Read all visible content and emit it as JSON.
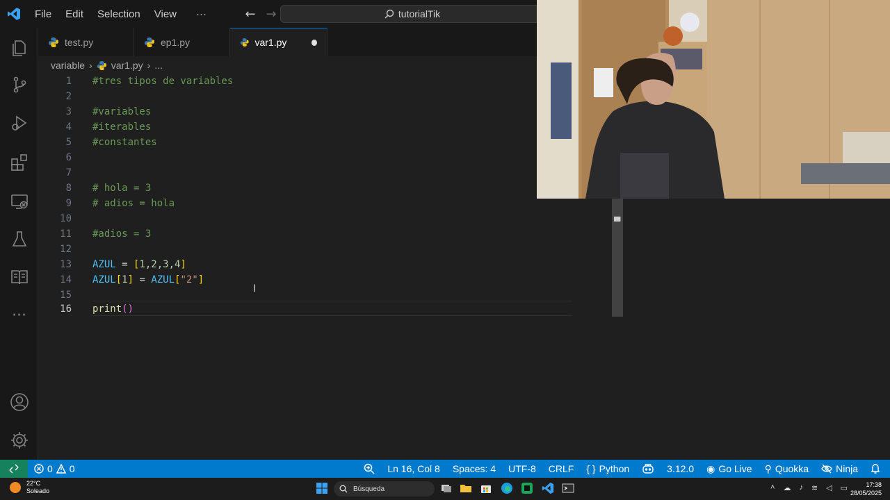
{
  "titlebar": {
    "menu": [
      "File",
      "Edit",
      "Selection",
      "View"
    ],
    "more": "···",
    "search_text": "tutorialTik"
  },
  "tabs": [
    {
      "label": "test.py"
    },
    {
      "label": "ep1.py"
    },
    {
      "label": "var1.py"
    }
  ],
  "breadcrumb": {
    "folder": "variable",
    "file": "var1.py",
    "more": "..."
  },
  "editor": {
    "line_numbers": [
      "1",
      "2",
      "3",
      "4",
      "5",
      "6",
      "7",
      "8",
      "9",
      "10",
      "11",
      "12",
      "13",
      "14",
      "15",
      "16"
    ],
    "lines": {
      "l1": "#tres tipos de variables",
      "l3": "#variables",
      "l4": "#iterables",
      "l5": "#constantes",
      "l8": "# hola = 3",
      "l9": "# adios = hola",
      "l11": "#adios = 3",
      "l13_var": "AZUL",
      "l13_eq": " = ",
      "l13_open": "[",
      "l13_vals": "1,2,3,4",
      "l13_close": "]",
      "l14_var": "AZUL",
      "l14_open": "[",
      "l14_idx": "1",
      "l14_close": "]",
      "l14_eq": " = ",
      "l14_var2": "AZUL",
      "l14_open2": "[",
      "l14_str": "\"2\"",
      "l14_close2": "]",
      "l16_fn": "print",
      "l16_parens": "()"
    }
  },
  "statusbar": {
    "errors": "0",
    "warnings": "0",
    "position": "Ln 16, Col 8",
    "spaces": "Spaces: 4",
    "encoding": "UTF-8",
    "eol": "CRLF",
    "language": "Python",
    "version": "3.12.0",
    "golive": "Go Live",
    "quokka": "Quokka",
    "ninja": "Ninja"
  },
  "taskbar": {
    "temperature": "22°C",
    "weather": "Soleado",
    "search_placeholder": "Búsqueda",
    "time": "17:38",
    "date": "28/05/2025"
  },
  "colors": {
    "statusbar": "#007acc",
    "accent": "#0078d4",
    "comment": "#6a9955"
  }
}
